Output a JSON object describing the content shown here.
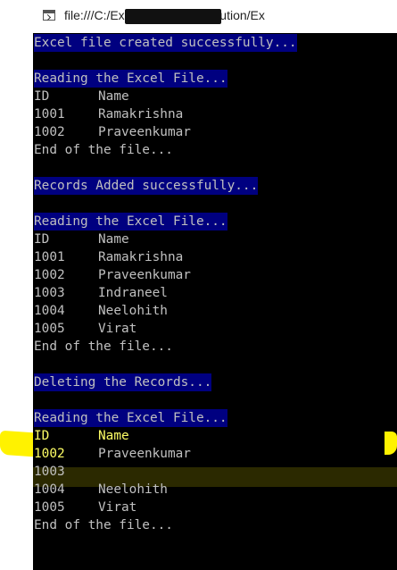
{
  "window": {
    "title": "file:///C:/ExcelOperationsSolution/Ex"
  },
  "console": {
    "msg_created": "Excel file created successfully...",
    "read1": {
      "header": "Reading the Excel File...",
      "col_id": "ID",
      "col_name": "Name",
      "rows": [
        {
          "id": "1001",
          "name": "Ramakrishna"
        },
        {
          "id": "1002",
          "name": "Praveenkumar"
        }
      ],
      "end": "End of the file..."
    },
    "msg_added": "Records Added successfully...",
    "read2": {
      "header": "Reading the Excel File...",
      "col_id": "ID",
      "col_name": "Name",
      "rows": [
        {
          "id": "1001",
          "name": "Ramakrishna"
        },
        {
          "id": "1002",
          "name": "Praveenkumar"
        },
        {
          "id": "1003",
          "name": "Indraneel"
        },
        {
          "id": "1004",
          "name": "Neelohith"
        },
        {
          "id": "1005",
          "name": "Virat"
        }
      ],
      "end": "End of the file..."
    },
    "msg_deleting": "Deleting the Records...",
    "read3": {
      "header": "Reading the Excel File...",
      "col_id": "ID",
      "col_name": "Name",
      "rows": [
        {
          "id": "1002",
          "name": "Praveenkumar"
        },
        {
          "id": "1003",
          "name": ""
        },
        {
          "id": "1004",
          "name": "Neelohith"
        },
        {
          "id": "1005",
          "name": "Virat"
        }
      ],
      "end": "End of the file..."
    }
  },
  "colors": {
    "console_bg": "#000000",
    "console_text": "#c0c0c0",
    "message_bg": "#000080",
    "highlighter": "#fff200",
    "highlighted_text": "#ffff66"
  }
}
